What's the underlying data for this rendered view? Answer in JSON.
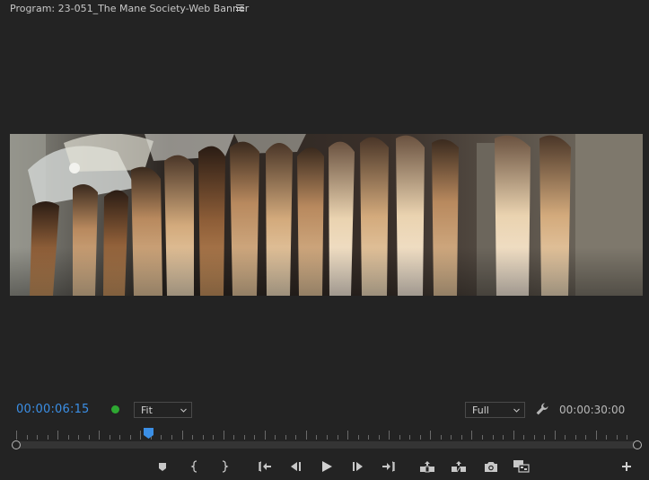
{
  "panel": {
    "title": "Program: 23-051_The Mane Society-Web Banner",
    "menu_icon": "hamburger-menu-icon"
  },
  "timecode": {
    "current": "00:00:06:15",
    "duration": "00:00:30:00",
    "current_color": "#3b8fe6"
  },
  "zoom": {
    "value": "Fit",
    "options_icon": "chevron-down-icon"
  },
  "resolution": {
    "value": "Full",
    "options_icon": "chevron-down-icon"
  },
  "status": {
    "color": "#2ea832"
  },
  "playhead": {
    "position_fraction": 0.2125
  },
  "controls": [
    {
      "name": "add-marker-button",
      "icon": "marker-icon"
    },
    {
      "name": "mark-in-button",
      "icon": "mark-in-icon"
    },
    {
      "name": "mark-out-button",
      "icon": "mark-out-icon"
    },
    {
      "name": "go-to-in-button",
      "icon": "go-to-in-icon"
    },
    {
      "name": "step-back-button",
      "icon": "step-back-icon"
    },
    {
      "name": "play-button",
      "icon": "play-icon"
    },
    {
      "name": "step-forward-button",
      "icon": "step-forward-icon"
    },
    {
      "name": "go-to-out-button",
      "icon": "go-to-out-icon"
    },
    {
      "name": "lift-button",
      "icon": "lift-icon"
    },
    {
      "name": "extract-button",
      "icon": "extract-icon"
    },
    {
      "name": "export-frame-button",
      "icon": "camera-icon"
    },
    {
      "name": "comparison-view-button",
      "icon": "comparison-view-icon"
    },
    {
      "name": "button-editor-button",
      "icon": "plus-icon"
    }
  ]
}
